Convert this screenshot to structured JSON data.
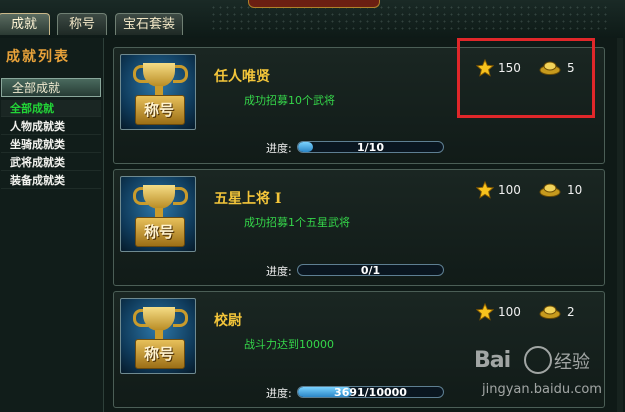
{
  "tabs": [
    {
      "label": "成就",
      "active": true
    },
    {
      "label": "称号",
      "active": false
    },
    {
      "label": "宝石套装",
      "active": false
    }
  ],
  "sidebar": {
    "title": "成就列表",
    "category_header": "全部成就",
    "items": [
      {
        "label": "全部成就",
        "selected": true
      },
      {
        "label": "人物成就类",
        "selected": false
      },
      {
        "label": "坐骑成就类",
        "selected": false
      },
      {
        "label": "武将成就类",
        "selected": false
      },
      {
        "label": "装备成就类",
        "selected": false
      }
    ]
  },
  "achievements": [
    {
      "badge_text": "称号",
      "title": "任人唯贤",
      "desc": "成功招募10个武将",
      "stars": "150",
      "gold": "5",
      "progress_label": "进度:",
      "progress_text": "1/10",
      "progress": 0.1
    },
    {
      "badge_text": "称号",
      "title": "五星上将 I",
      "desc": "成功招募1个五星武将",
      "stars": "100",
      "gold": "10",
      "progress_label": "进度:",
      "progress_text": "0/1",
      "progress": 0.0
    },
    {
      "badge_text": "称号",
      "title": "校尉",
      "desc": "战斗力达到10000",
      "stars": "100",
      "gold": "2",
      "progress_label": "进度:",
      "progress_text": "3691/10000",
      "progress": 0.3691
    }
  ],
  "watermark": {
    "brand": "Bai",
    "brand_cn": "经验",
    "url": "jingyan.baidu.com"
  },
  "colors": {
    "title": "#f3c53a",
    "desc": "#35d64a",
    "selected_category": "#22d437",
    "highlight_box": "#e0272a",
    "progress_fill": "#3a9de0"
  }
}
